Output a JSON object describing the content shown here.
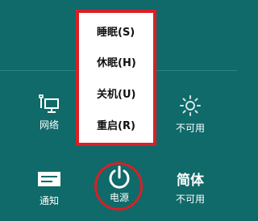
{
  "menu": {
    "items": [
      {
        "label": "睡眠(S)"
      },
      {
        "label": "休眠(H)"
      },
      {
        "label": "关机(U)"
      },
      {
        "label": "重启(R)"
      }
    ]
  },
  "settings": {
    "network_label": "网络",
    "brightness_label": "不可用",
    "notifications_label": "通知",
    "power_label": "电源",
    "ime_mode": "简体",
    "ime_label": "不可用"
  },
  "colors": {
    "background": "#0f6a69",
    "highlight": "#d91f26",
    "menu_bg": "#ffffff"
  },
  "icons": [
    "network-icon",
    "brightness-icon",
    "notifications-icon",
    "power-icon"
  ]
}
